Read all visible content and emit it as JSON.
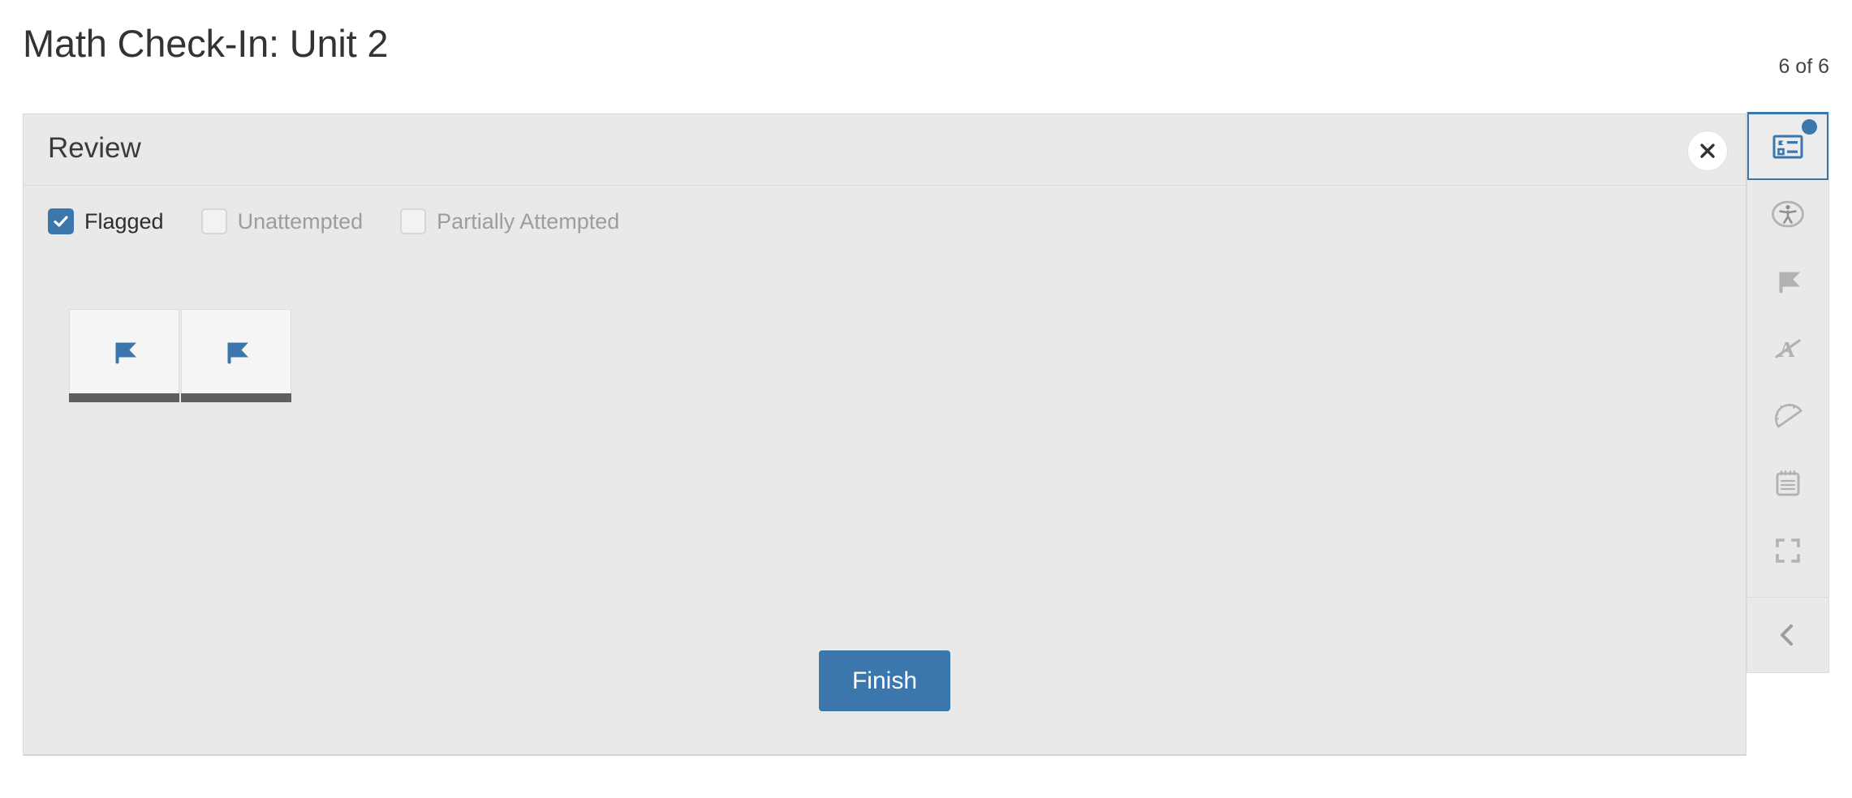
{
  "header": {
    "title": "Math Check-In: Unit 2",
    "counter": "6 of 6"
  },
  "review_panel": {
    "title": "Review",
    "close_label": "close-icon",
    "filters": [
      {
        "label": "Flagged",
        "checked": true,
        "name": "filter-flagged"
      },
      {
        "label": "Unattempted",
        "checked": false,
        "name": "filter-unattempted"
      },
      {
        "label": "Partially Attempted",
        "checked": false,
        "name": "filter-partially-attempted"
      }
    ],
    "tiles": [
      {
        "icon": "flag-icon",
        "status": "flagged"
      },
      {
        "icon": "flag-icon",
        "status": "flagged"
      }
    ],
    "finish_label": "Finish"
  },
  "toolbar": {
    "items": [
      {
        "icon": "review-list-icon",
        "label": "Review",
        "active": true,
        "badge": true
      },
      {
        "icon": "accessibility-icon",
        "label": "Accessibility",
        "active": false,
        "badge": false
      },
      {
        "icon": "flag-icon",
        "label": "Flag",
        "active": false,
        "badge": false
      },
      {
        "icon": "answer-eliminator-icon",
        "label": "Answer Eliminator",
        "active": false,
        "badge": false
      },
      {
        "icon": "protractor-icon",
        "label": "Protractor",
        "active": false,
        "badge": false
      },
      {
        "icon": "notepad-icon",
        "label": "Notepad",
        "active": false,
        "badge": false
      },
      {
        "icon": "fullscreen-icon",
        "label": "Full Screen",
        "active": false,
        "badge": false
      }
    ],
    "collapse": {
      "icon": "chevron-left-icon",
      "label": "Collapse"
    }
  },
  "colors": {
    "accent_blue": "#3b76ac",
    "panel_gray": "#e9e9e9",
    "tile_gray": "#f5f5f5",
    "tile_bar_gray": "#5f5f5f",
    "muted_text": "#9d9d9d",
    "icon_gray": "#b2b2b2"
  }
}
